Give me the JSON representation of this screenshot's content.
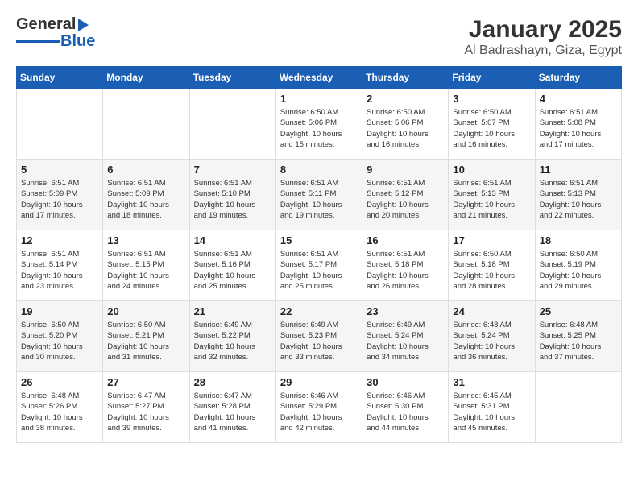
{
  "logo": {
    "line1": "General",
    "line2": "Blue"
  },
  "title": "January 2025",
  "subtitle": "Al Badrashayn, Giza, Egypt",
  "weekdays": [
    "Sunday",
    "Monday",
    "Tuesday",
    "Wednesday",
    "Thursday",
    "Friday",
    "Saturday"
  ],
  "weeks": [
    [
      {
        "day": "",
        "detail": ""
      },
      {
        "day": "",
        "detail": ""
      },
      {
        "day": "",
        "detail": ""
      },
      {
        "day": "1",
        "detail": "Sunrise: 6:50 AM\nSunset: 5:06 PM\nDaylight: 10 hours\nand 15 minutes."
      },
      {
        "day": "2",
        "detail": "Sunrise: 6:50 AM\nSunset: 5:06 PM\nDaylight: 10 hours\nand 16 minutes."
      },
      {
        "day": "3",
        "detail": "Sunrise: 6:50 AM\nSunset: 5:07 PM\nDaylight: 10 hours\nand 16 minutes."
      },
      {
        "day": "4",
        "detail": "Sunrise: 6:51 AM\nSunset: 5:08 PM\nDaylight: 10 hours\nand 17 minutes."
      }
    ],
    [
      {
        "day": "5",
        "detail": "Sunrise: 6:51 AM\nSunset: 5:09 PM\nDaylight: 10 hours\nand 17 minutes."
      },
      {
        "day": "6",
        "detail": "Sunrise: 6:51 AM\nSunset: 5:09 PM\nDaylight: 10 hours\nand 18 minutes."
      },
      {
        "day": "7",
        "detail": "Sunrise: 6:51 AM\nSunset: 5:10 PM\nDaylight: 10 hours\nand 19 minutes."
      },
      {
        "day": "8",
        "detail": "Sunrise: 6:51 AM\nSunset: 5:11 PM\nDaylight: 10 hours\nand 19 minutes."
      },
      {
        "day": "9",
        "detail": "Sunrise: 6:51 AM\nSunset: 5:12 PM\nDaylight: 10 hours\nand 20 minutes."
      },
      {
        "day": "10",
        "detail": "Sunrise: 6:51 AM\nSunset: 5:13 PM\nDaylight: 10 hours\nand 21 minutes."
      },
      {
        "day": "11",
        "detail": "Sunrise: 6:51 AM\nSunset: 5:13 PM\nDaylight: 10 hours\nand 22 minutes."
      }
    ],
    [
      {
        "day": "12",
        "detail": "Sunrise: 6:51 AM\nSunset: 5:14 PM\nDaylight: 10 hours\nand 23 minutes."
      },
      {
        "day": "13",
        "detail": "Sunrise: 6:51 AM\nSunset: 5:15 PM\nDaylight: 10 hours\nand 24 minutes."
      },
      {
        "day": "14",
        "detail": "Sunrise: 6:51 AM\nSunset: 5:16 PM\nDaylight: 10 hours\nand 25 minutes."
      },
      {
        "day": "15",
        "detail": "Sunrise: 6:51 AM\nSunset: 5:17 PM\nDaylight: 10 hours\nand 25 minutes."
      },
      {
        "day": "16",
        "detail": "Sunrise: 6:51 AM\nSunset: 5:18 PM\nDaylight: 10 hours\nand 26 minutes."
      },
      {
        "day": "17",
        "detail": "Sunrise: 6:50 AM\nSunset: 5:18 PM\nDaylight: 10 hours\nand 28 minutes."
      },
      {
        "day": "18",
        "detail": "Sunrise: 6:50 AM\nSunset: 5:19 PM\nDaylight: 10 hours\nand 29 minutes."
      }
    ],
    [
      {
        "day": "19",
        "detail": "Sunrise: 6:50 AM\nSunset: 5:20 PM\nDaylight: 10 hours\nand 30 minutes."
      },
      {
        "day": "20",
        "detail": "Sunrise: 6:50 AM\nSunset: 5:21 PM\nDaylight: 10 hours\nand 31 minutes."
      },
      {
        "day": "21",
        "detail": "Sunrise: 6:49 AM\nSunset: 5:22 PM\nDaylight: 10 hours\nand 32 minutes."
      },
      {
        "day": "22",
        "detail": "Sunrise: 6:49 AM\nSunset: 5:23 PM\nDaylight: 10 hours\nand 33 minutes."
      },
      {
        "day": "23",
        "detail": "Sunrise: 6:49 AM\nSunset: 5:24 PM\nDaylight: 10 hours\nand 34 minutes."
      },
      {
        "day": "24",
        "detail": "Sunrise: 6:48 AM\nSunset: 5:24 PM\nDaylight: 10 hours\nand 36 minutes."
      },
      {
        "day": "25",
        "detail": "Sunrise: 6:48 AM\nSunset: 5:25 PM\nDaylight: 10 hours\nand 37 minutes."
      }
    ],
    [
      {
        "day": "26",
        "detail": "Sunrise: 6:48 AM\nSunset: 5:26 PM\nDaylight: 10 hours\nand 38 minutes."
      },
      {
        "day": "27",
        "detail": "Sunrise: 6:47 AM\nSunset: 5:27 PM\nDaylight: 10 hours\nand 39 minutes."
      },
      {
        "day": "28",
        "detail": "Sunrise: 6:47 AM\nSunset: 5:28 PM\nDaylight: 10 hours\nand 41 minutes."
      },
      {
        "day": "29",
        "detail": "Sunrise: 6:46 AM\nSunset: 5:29 PM\nDaylight: 10 hours\nand 42 minutes."
      },
      {
        "day": "30",
        "detail": "Sunrise: 6:46 AM\nSunset: 5:30 PM\nDaylight: 10 hours\nand 44 minutes."
      },
      {
        "day": "31",
        "detail": "Sunrise: 6:45 AM\nSunset: 5:31 PM\nDaylight: 10 hours\nand 45 minutes."
      },
      {
        "day": "",
        "detail": ""
      }
    ]
  ]
}
